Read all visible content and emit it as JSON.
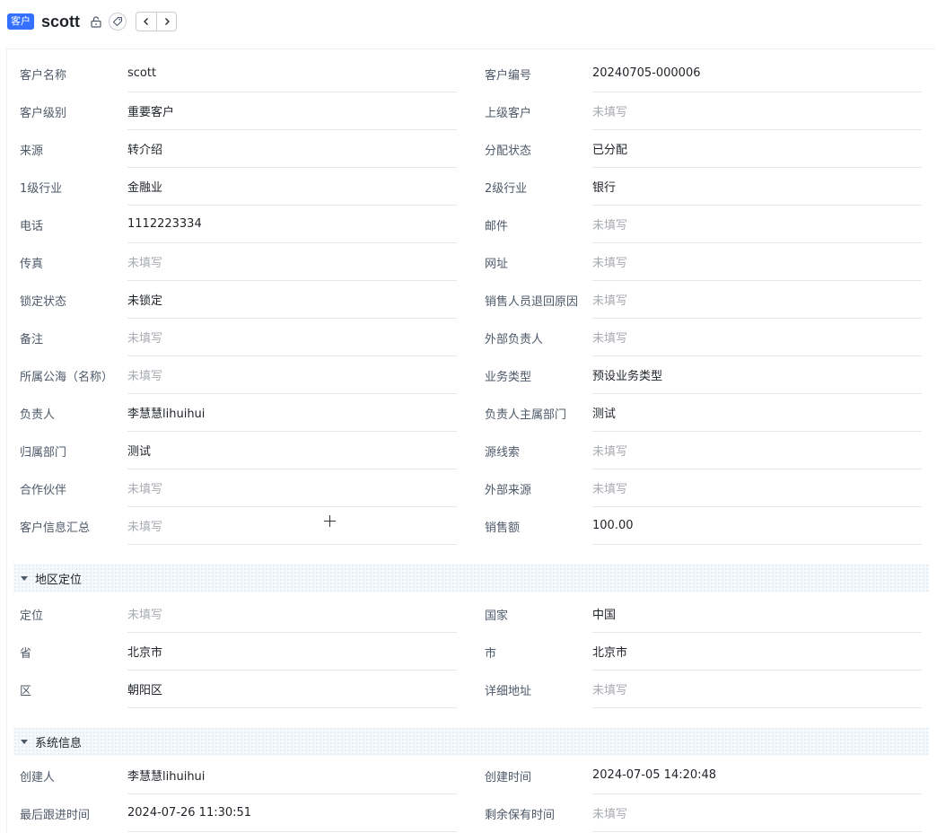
{
  "header": {
    "type_badge": "客户",
    "title": "scott",
    "icons": {
      "lock": "unlock-icon",
      "tag": "tag-icon",
      "prev": "chevron-left-icon",
      "next": "chevron-right-icon"
    }
  },
  "main_fields": [
    {
      "label": "客户名称",
      "value": "scott",
      "empty": false
    },
    {
      "label": "客户编号",
      "value": "20240705-000006",
      "empty": false
    },
    {
      "label": "客户级别",
      "value": "重要客户",
      "empty": false
    },
    {
      "label": "上级客户",
      "value": "未填写",
      "empty": true
    },
    {
      "label": "来源",
      "value": "转介绍",
      "empty": false
    },
    {
      "label": "分配状态",
      "value": "已分配",
      "empty": false
    },
    {
      "label": "1级行业",
      "value": "金融业",
      "empty": false
    },
    {
      "label": "2级行业",
      "value": "银行",
      "empty": false
    },
    {
      "label": "电话",
      "value": "1112223334",
      "empty": false
    },
    {
      "label": "邮件",
      "value": "未填写",
      "empty": true
    },
    {
      "label": "传真",
      "value": "未填写",
      "empty": true
    },
    {
      "label": "网址",
      "value": "未填写",
      "empty": true
    },
    {
      "label": "锁定状态",
      "value": "未锁定",
      "empty": false
    },
    {
      "label": "销售人员退回原因",
      "value": "未填写",
      "empty": true
    },
    {
      "label": "备注",
      "value": "未填写",
      "empty": true
    },
    {
      "label": "外部负责人",
      "value": "未填写",
      "empty": true
    },
    {
      "label": "所属公海（名称）",
      "value": "未填写",
      "empty": true
    },
    {
      "label": "业务类型",
      "value": "预设业务类型",
      "empty": false
    },
    {
      "label": "负责人",
      "value": "李慧慧lihuihui",
      "empty": false
    },
    {
      "label": "负责人主属部门",
      "value": "测试",
      "empty": false
    },
    {
      "label": "归属部门",
      "value": "测试",
      "empty": false
    },
    {
      "label": "源线索",
      "value": "未填写",
      "empty": true
    },
    {
      "label": "合作伙伴",
      "value": "未填写",
      "empty": true
    },
    {
      "label": "外部来源",
      "value": "未填写",
      "empty": true
    },
    {
      "label": "客户信息汇总",
      "value": "未填写",
      "empty": true
    },
    {
      "label": "销售额",
      "value": "100.00",
      "empty": false
    }
  ],
  "region_section": {
    "title": "地区定位",
    "fields": [
      {
        "label": "定位",
        "value": "未填写",
        "empty": true
      },
      {
        "label": "国家",
        "value": "中国",
        "empty": false
      },
      {
        "label": "省",
        "value": "北京市",
        "empty": false
      },
      {
        "label": "市",
        "value": "北京市",
        "empty": false
      },
      {
        "label": "区",
        "value": "朝阳区",
        "empty": false
      },
      {
        "label": "详细地址",
        "value": "未填写",
        "empty": true
      }
    ]
  },
  "system_section": {
    "title": "系统信息",
    "fields": [
      {
        "label": "创建人",
        "value": "李慧慧lihuihui",
        "empty": false
      },
      {
        "label": "创建时间",
        "value": "2024-07-05 14:20:48",
        "empty": false
      },
      {
        "label": "最后跟进时间",
        "value": "2024-07-26 11:30:51",
        "empty": false
      },
      {
        "label": "剩余保有时间",
        "value": "未填写",
        "empty": true
      }
    ]
  },
  "colors": {
    "accent": "#3370ff",
    "label": "#4e5969",
    "empty_value": "#a8abb2",
    "divider": "#e5e6eb"
  }
}
